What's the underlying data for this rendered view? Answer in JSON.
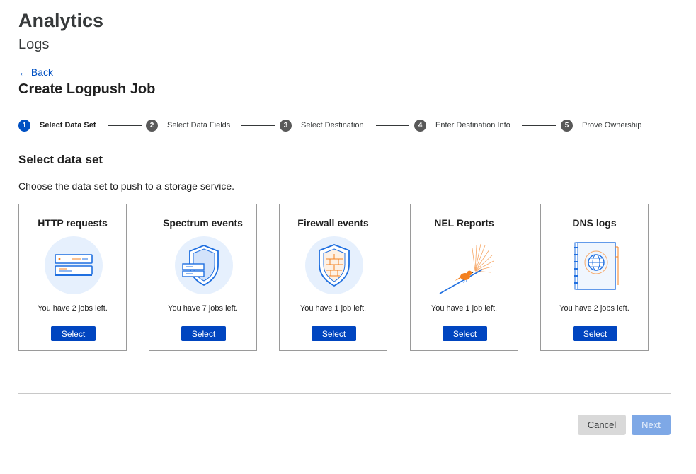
{
  "header": {
    "title": "Analytics",
    "subtitle": "Logs",
    "back_label": "← Back",
    "page_title": "Create Logpush Job"
  },
  "stepper": {
    "active_step": 1,
    "steps": [
      {
        "number": "1",
        "label": "Select Data Set"
      },
      {
        "number": "2",
        "label": "Select Data Fields"
      },
      {
        "number": "3",
        "label": "Select Destination"
      },
      {
        "number": "4",
        "label": "Enter Destination Info"
      },
      {
        "number": "5",
        "label": "Prove Ownership"
      }
    ]
  },
  "section": {
    "title": "Select data set",
    "description": "Choose the data set to push to a storage service."
  },
  "cards": [
    {
      "title": "HTTP requests",
      "jobs_text": "You have 2 jobs left.",
      "button_label": "Select",
      "icon": "server-icon"
    },
    {
      "title": "Spectrum events",
      "jobs_text": "You have 7 jobs left.",
      "button_label": "Select",
      "icon": "shield-server-icon"
    },
    {
      "title": "Firewall events",
      "jobs_text": "You have 1 job left.",
      "button_label": "Select",
      "icon": "firewall-shield-icon"
    },
    {
      "title": "NEL Reports",
      "jobs_text": "You have 1 job left.",
      "button_label": "Select",
      "icon": "bird-icon"
    },
    {
      "title": "DNS logs",
      "jobs_text": "You have 2 jobs left.",
      "button_label": "Select",
      "icon": "notebook-globe-icon"
    }
  ],
  "footer": {
    "cancel_label": "Cancel",
    "next_label": "Next"
  },
  "colors": {
    "primary": "#0045c0",
    "link": "#0051c3",
    "illustration_blue": "#1f6fe0",
    "illustration_bg": "#e6f0fd",
    "accent_orange": "#f48120"
  }
}
